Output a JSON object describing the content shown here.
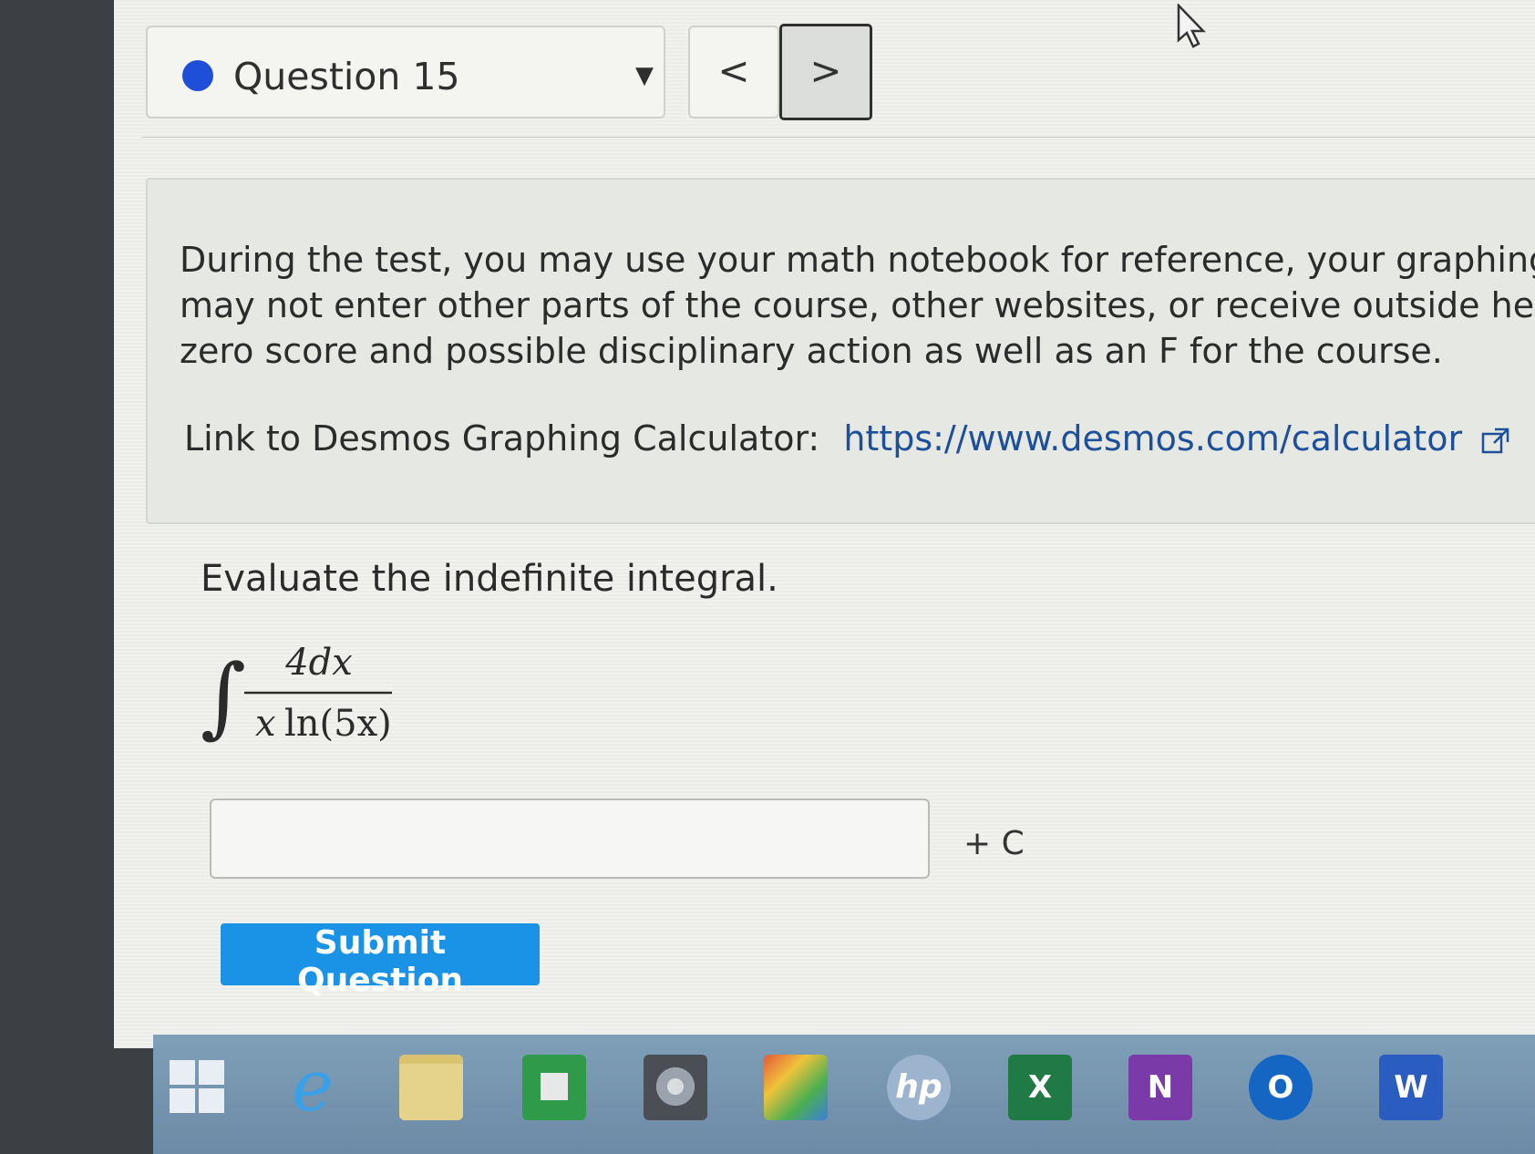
{
  "question_nav": {
    "label": "Question 15",
    "prev_symbol": "<",
    "next_symbol": ">"
  },
  "info": {
    "lines": [
      "During the test, you may use your math notebook for reference, your graphing",
      "may not enter other parts of the course, other websites, or receive outside hel",
      "zero score and possible disciplinary action as well as an F for the course."
    ],
    "desmos_label": "Link to Desmos Graphing Calculator:",
    "desmos_url": "https://www.desmos.com/calculator"
  },
  "question": {
    "prompt": "Evaluate the indefinite integral.",
    "numerator": "4dx",
    "denominator_var": "x",
    "denominator_fn": "ln(5x)",
    "answer_value": "",
    "constant": "+ C"
  },
  "submit_label": "Submit Question",
  "taskbar": {
    "excel_letter": "X",
    "onenote_letter": "N",
    "outlook_letter": "O",
    "word_letter": "W",
    "hp_text": "hp",
    "ie_letter": "e"
  },
  "colors": {
    "accent": "#1a92e6",
    "question_dot": "#1f4fd8",
    "link": "#1d4f9a"
  }
}
